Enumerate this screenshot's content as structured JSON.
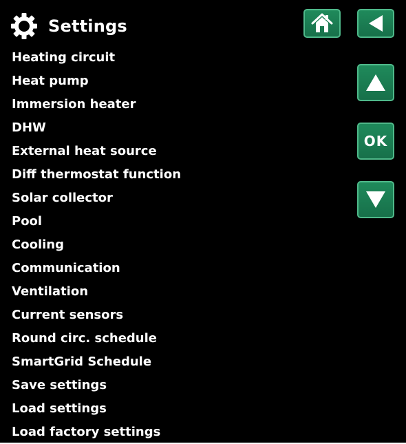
{
  "header": {
    "title": "Settings",
    "icon": "gear-icon"
  },
  "menu": {
    "items": [
      "Heating circuit",
      "Heat pump",
      "Immersion heater",
      "DHW",
      "External heat source",
      "Diff thermostat function",
      "Solar collector",
      "Pool",
      "Cooling",
      "Communication",
      "Ventilation",
      "Current sensors",
      "Round circ. schedule",
      "SmartGrid Schedule",
      "Save settings",
      "Load settings",
      "Load factory settings"
    ]
  },
  "buttons": {
    "home": "home-icon",
    "back": "back-arrow-icon",
    "up": "up-arrow-icon",
    "ok_label": "OK",
    "down": "down-arrow-icon"
  },
  "colors": {
    "background": "#000000",
    "button_fill": "#1b7d52",
    "button_border": "#4fb98a",
    "text": "#ffffff"
  }
}
